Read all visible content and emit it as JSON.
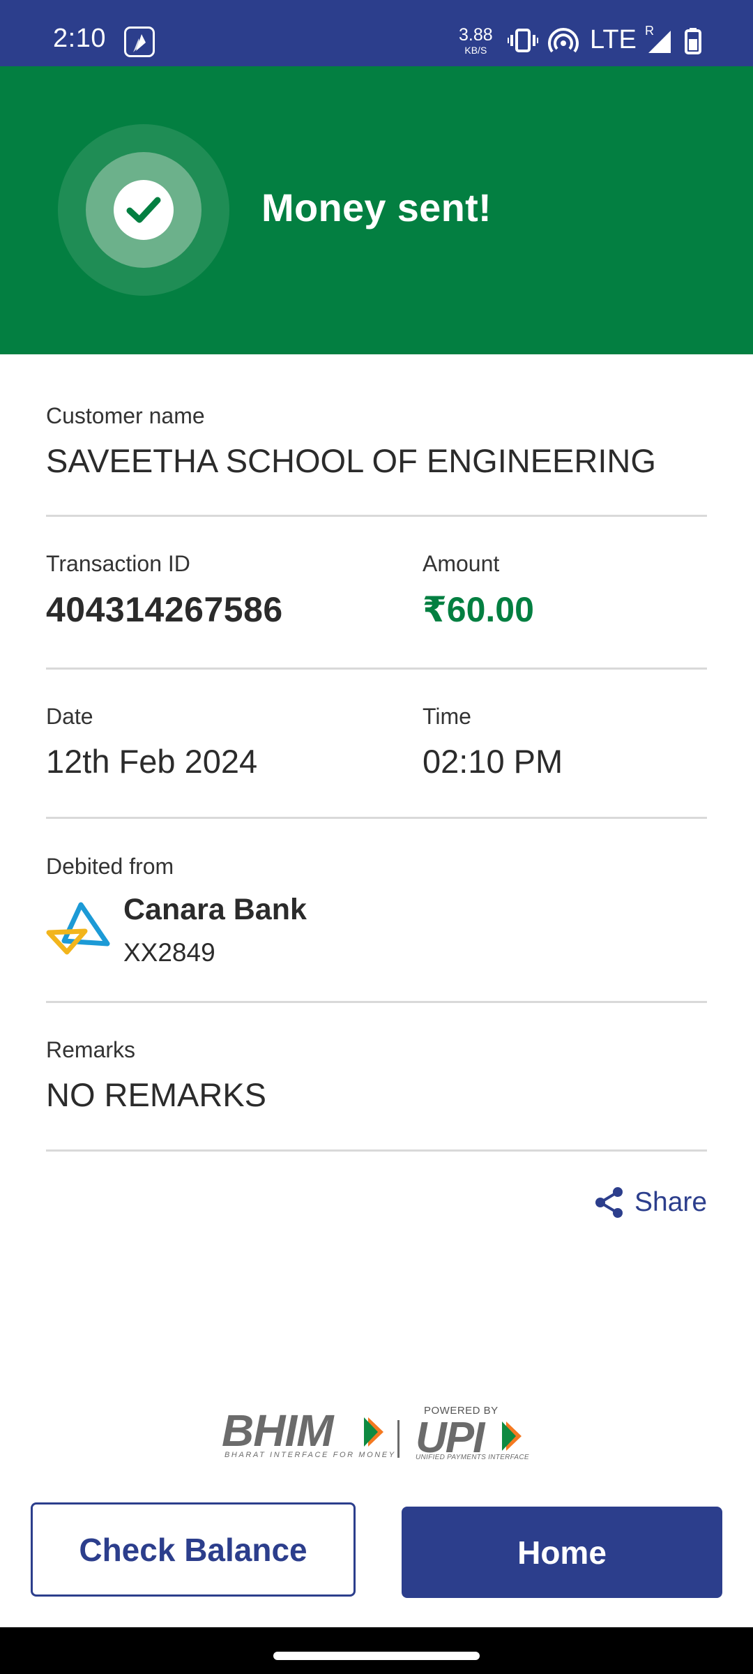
{
  "status_bar": {
    "time": "2:10",
    "speed_value": "3.88",
    "speed_unit": "KB/S",
    "network": "LTE",
    "roaming": "R",
    "icons": [
      "bhim-app-icon",
      "vibrate-icon",
      "hotspot-icon",
      "signal-icon",
      "battery-icon"
    ]
  },
  "header": {
    "title": "Money sent!",
    "icon": "check-icon",
    "background": "#037f41"
  },
  "details": {
    "customer_label": "Customer name",
    "customer_value": "SAVEETHA SCHOOL OF ENGINEERING",
    "txn_label": "Transaction ID",
    "txn_value": "404314267586",
    "amount_label": "Amount",
    "amount_value": "₹60.00",
    "date_label": "Date",
    "date_value": "12th Feb 2024",
    "time_label": "Time",
    "time_value": "02:10 PM",
    "debited_label": "Debited from",
    "bank_name": "Canara Bank",
    "bank_account": "XX2849",
    "remarks_label": "Remarks",
    "remarks_value": "NO REMARKS"
  },
  "share": {
    "label": "Share",
    "icon": "share-icon"
  },
  "footer": {
    "bhim": "BHIM",
    "bhim_tagline": "BHARAT INTERFACE FOR MONEY",
    "powered_by": "POWERED BY",
    "upi": "UPI",
    "upi_tagline": "UNIFIED PAYMENTS INTERFACE"
  },
  "buttons": {
    "check_balance": "Check Balance",
    "home": "Home"
  },
  "colors": {
    "brand": "#2c3e8c",
    "success": "#037f41",
    "divider": "#d9d9d9"
  }
}
